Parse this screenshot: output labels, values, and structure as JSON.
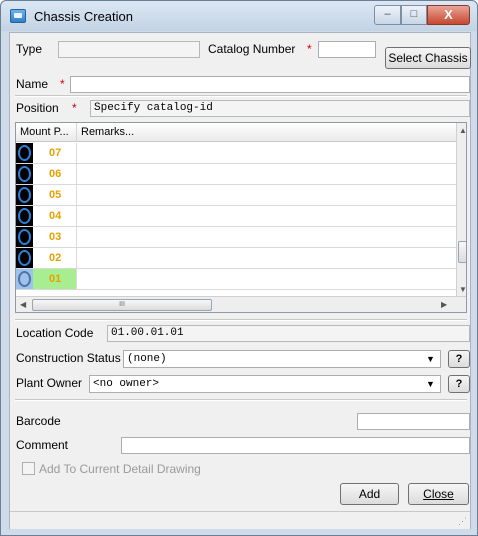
{
  "window": {
    "title": "Chassis Creation",
    "controls": {
      "minimize": "–",
      "maximize": "□",
      "close": "X"
    }
  },
  "form": {
    "type_label": "Type",
    "type_value": "",
    "catalog_number_label": "Catalog Number",
    "catalog_number_required": "*",
    "catalog_number_value": "",
    "select_chassis_label": "Select Chassis",
    "name_label": "Name",
    "name_required": "*",
    "name_value": "",
    "position_label": "Position",
    "position_required": "*",
    "position_value": "Specify catalog-id"
  },
  "table": {
    "columns": [
      "Mount P...",
      "Remarks..."
    ],
    "rows": [
      {
        "mount": "07",
        "remarks": ""
      },
      {
        "mount": "06",
        "remarks": ""
      },
      {
        "mount": "05",
        "remarks": ""
      },
      {
        "mount": "04",
        "remarks": ""
      },
      {
        "mount": "03",
        "remarks": ""
      },
      {
        "mount": "02",
        "remarks": ""
      },
      {
        "mount": "01",
        "remarks": "",
        "selected": true
      }
    ],
    "hscroll_grip": "III"
  },
  "location": {
    "label": "Location Code",
    "value": "01.00.01.01"
  },
  "construction_status": {
    "label": "Construction Status",
    "value": "(none)",
    "help": "?"
  },
  "plant_owner": {
    "label": "Plant Owner",
    "value": "<no owner>",
    "help": "?"
  },
  "barcode": {
    "label": "Barcode",
    "value": ""
  },
  "comment": {
    "label": "Comment",
    "value": ""
  },
  "add_to_drawing": {
    "label": "Add To Current Detail Drawing",
    "checked": false,
    "enabled": false
  },
  "buttons": {
    "add": "Add",
    "close": "Close"
  },
  "colors": {
    "mount_number": "#e8a000",
    "selected_row": "#a8ee90",
    "required_marker": "#d40000",
    "titlebar": "#c3d3e4"
  }
}
